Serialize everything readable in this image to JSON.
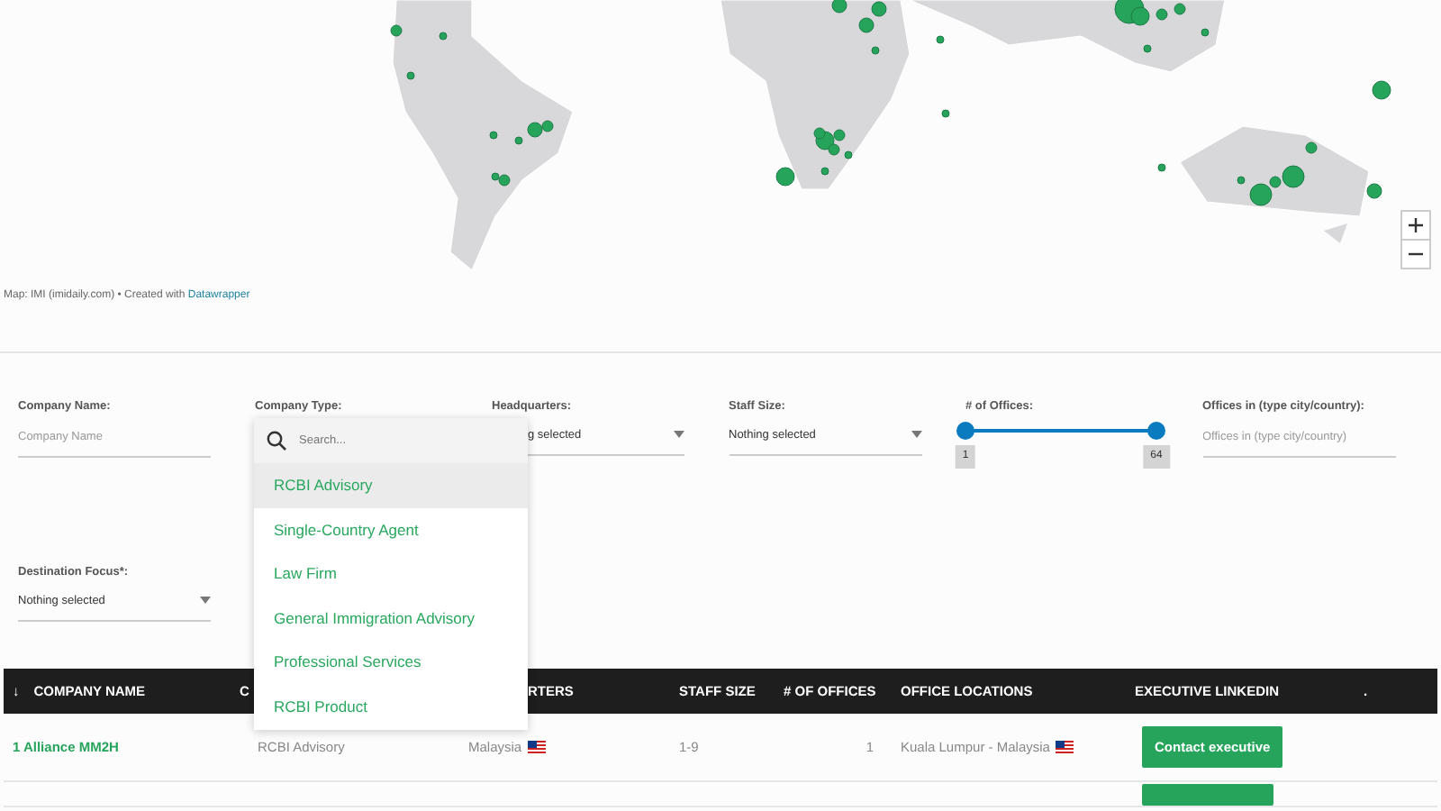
{
  "map": {
    "credit": "Map: IMI (imidaily.com) • Created with",
    "credit_link": "Datawrapper"
  },
  "filters": [
    {
      "kind": "text",
      "label": "Company Name:",
      "placeholder": "Company Name"
    },
    {
      "kind": "open",
      "label": "Company Type:"
    },
    {
      "kind": "select",
      "label": "Headquarters:",
      "value": "g selected",
      "covered": true
    },
    {
      "kind": "select",
      "label": "Staff Size:",
      "value": "Nothing selected"
    },
    {
      "kind": "range",
      "label": "# of Offices:",
      "handles": [
        {
          "level": 0,
          "label": "1"
        },
        {
          "level": 1,
          "label": "64"
        }
      ]
    },
    {
      "kind": "text",
      "label": "Offices in (type city/country):",
      "placeholder": "Offices in (type city/country)"
    },
    {
      "kind": "select",
      "label": "Destination Focus*:",
      "value": "Nothing selected"
    }
  ],
  "dropdown": {
    "search_placeholder": "Search...",
    "items": [
      {
        "label": "RCBI Advisory",
        "selected": true
      },
      {
        "label": "Single-Country Agent",
        "selected": false
      },
      {
        "label": "Law Firm",
        "selected": false
      },
      {
        "label": "General Immigration Advisory",
        "selected": false
      },
      {
        "label": "Professional Services",
        "selected": false
      },
      {
        "label": "RCBI Product",
        "selected": false
      }
    ]
  },
  "table": {
    "sort_icon": "↓",
    "columns": [
      "COMPANY NAME",
      "C",
      "RTERS",
      "STAFF SIZE",
      "# OF OFFICES",
      "OFFICE LOCATIONS",
      "EXECUTIVE LINKEDIN",
      "."
    ],
    "rows": [
      {
        "kind": "full",
        "company": "1 Alliance MM2H",
        "type": "RCBI Advisory",
        "headquarters": "Malaysia",
        "staff": "1-9",
        "offices": "1",
        "locations": "Kuala Lumpur - Malaysia",
        "button": "Contact executive"
      },
      {
        "kind": "cut"
      }
    ]
  }
}
